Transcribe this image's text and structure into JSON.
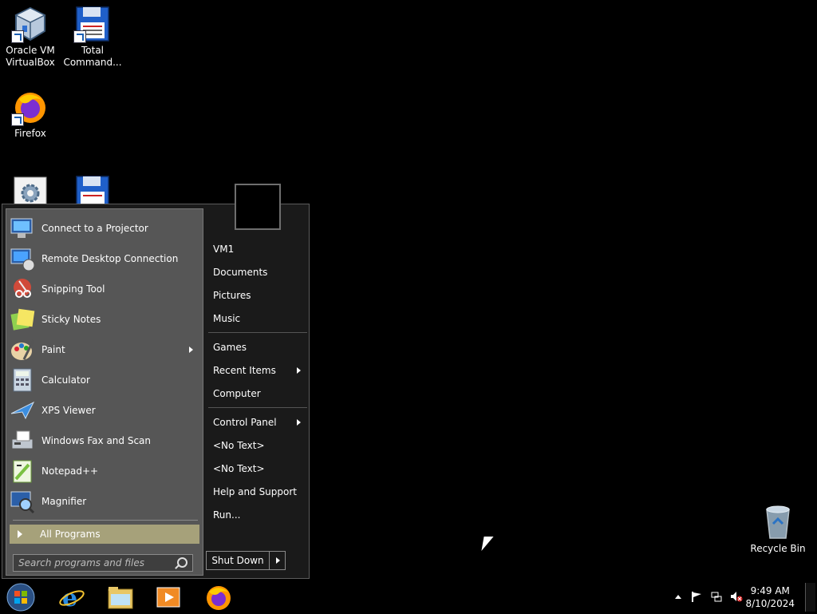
{
  "desktop": {
    "icons": [
      {
        "label_1": "Oracle VM",
        "label_2": "VirtualBox",
        "icon": "virtualbox-icon"
      },
      {
        "label_1": "Total",
        "label_2": "Command...",
        "icon": "floppy-icon"
      },
      {
        "label_1": "Firefox",
        "label_2": "",
        "icon": "firefox-icon"
      },
      {
        "label_1": "",
        "label_2": "",
        "icon": "settings-app-icon"
      },
      {
        "label_1": "",
        "label_2": "",
        "icon": "floppy-icon"
      },
      {
        "label_1": "Recycle Bin",
        "label_2": "",
        "icon": "recycle-bin-icon"
      }
    ]
  },
  "start_menu": {
    "programs": [
      {
        "label": "Connect to a Projector",
        "icon": "projector-icon",
        "submenu": false
      },
      {
        "label": "Remote Desktop Connection",
        "icon": "remote-desktop-icon",
        "submenu": false
      },
      {
        "label": "Snipping Tool",
        "icon": "scissors-icon",
        "submenu": false
      },
      {
        "label": "Sticky Notes",
        "icon": "sticky-notes-icon",
        "submenu": false
      },
      {
        "label": "Paint",
        "icon": "paint-palette-icon",
        "submenu": true
      },
      {
        "label": "Calculator",
        "icon": "calculator-icon",
        "submenu": false
      },
      {
        "label": "XPS Viewer",
        "icon": "xps-viewer-icon",
        "submenu": false
      },
      {
        "label": "Windows Fax and Scan",
        "icon": "fax-icon",
        "submenu": false
      },
      {
        "label": "Notepad++",
        "icon": "notepadpp-icon",
        "submenu": false
      },
      {
        "label": "Magnifier",
        "icon": "magnifier-icon",
        "submenu": false
      }
    ],
    "all_programs": "All Programs",
    "search_placeholder": "Search programs and files",
    "right_links": [
      {
        "label": "VM1",
        "submenu": false
      },
      {
        "label": "Documents",
        "submenu": false
      },
      {
        "label": "Pictures",
        "submenu": false
      },
      {
        "label": "Music",
        "submenu": false
      },
      {
        "label": "Games",
        "submenu": false
      },
      {
        "label": "Recent Items",
        "submenu": true
      },
      {
        "label": "Computer",
        "submenu": false
      },
      {
        "label": "Control Panel",
        "submenu": true
      },
      {
        "label": "<No Text>",
        "submenu": false
      },
      {
        "label": "<No Text>",
        "submenu": false
      },
      {
        "label": "Help and Support",
        "submenu": false
      },
      {
        "label": "Run...",
        "submenu": false
      }
    ],
    "shutdown_label": "Shut Down"
  },
  "taskbar": {
    "buttons": [
      "start-orb-icon",
      "internet-explorer-icon",
      "file-explorer-icon",
      "media-player-icon",
      "firefox-icon"
    ],
    "time": "9:49 AM",
    "date": "8/10/2024",
    "tray": [
      "show-hidden-icons-icon",
      "action-center-flag-icon",
      "network-icon",
      "volume-muted-icon"
    ]
  },
  "colors": {
    "desktop_bg": "#000000",
    "menu_left_pane": "#565656",
    "all_programs_highlight": "#a6a17a",
    "menu_right_pane": "#1a1a1a"
  }
}
